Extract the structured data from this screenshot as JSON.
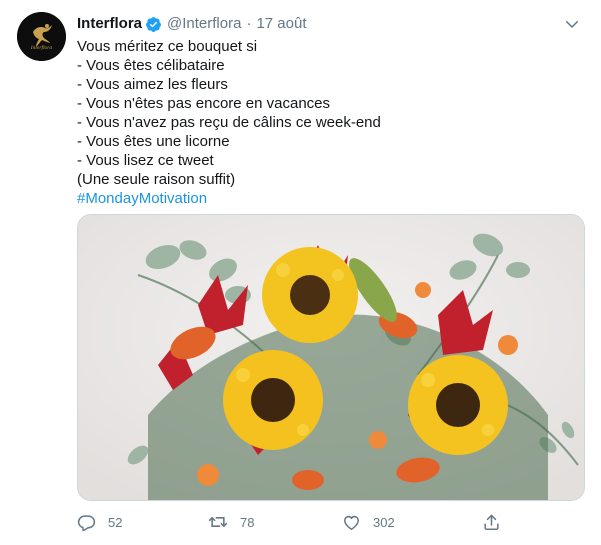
{
  "tweet": {
    "author_name": "Interflora",
    "verified_icon": "verified-badge-icon",
    "handle": "@Interflora",
    "separator": "·",
    "timestamp": "17 août",
    "avatar_logo_text": "Interflora",
    "lines": [
      "Vous méritez ce bouquet si",
      "- Vous êtes célibataire",
      "- Vous aimez les fleurs",
      "- Vous n'êtes pas encore en vacances",
      "- Vous n'avez pas reçu de câlins ce week-end",
      "- Vous êtes une licorne",
      "- Vous lisez ce tweet",
      "(Une seule raison suffit)"
    ],
    "hashtag": "#MondayMotivation",
    "media": {
      "description_icon": "flower-bouquet-photo"
    }
  },
  "actions": {
    "reply": {
      "icon": "reply-icon",
      "count": "52"
    },
    "retweet": {
      "icon": "retweet-icon",
      "count": "78"
    },
    "like": {
      "icon": "heart-icon",
      "count": "302"
    },
    "share": {
      "icon": "share-icon"
    }
  },
  "colors": {
    "text": "#14171a",
    "secondary": "#657786",
    "link": "#1b95e0",
    "verified": "#1da1f2",
    "border": "#ccd6dd"
  }
}
